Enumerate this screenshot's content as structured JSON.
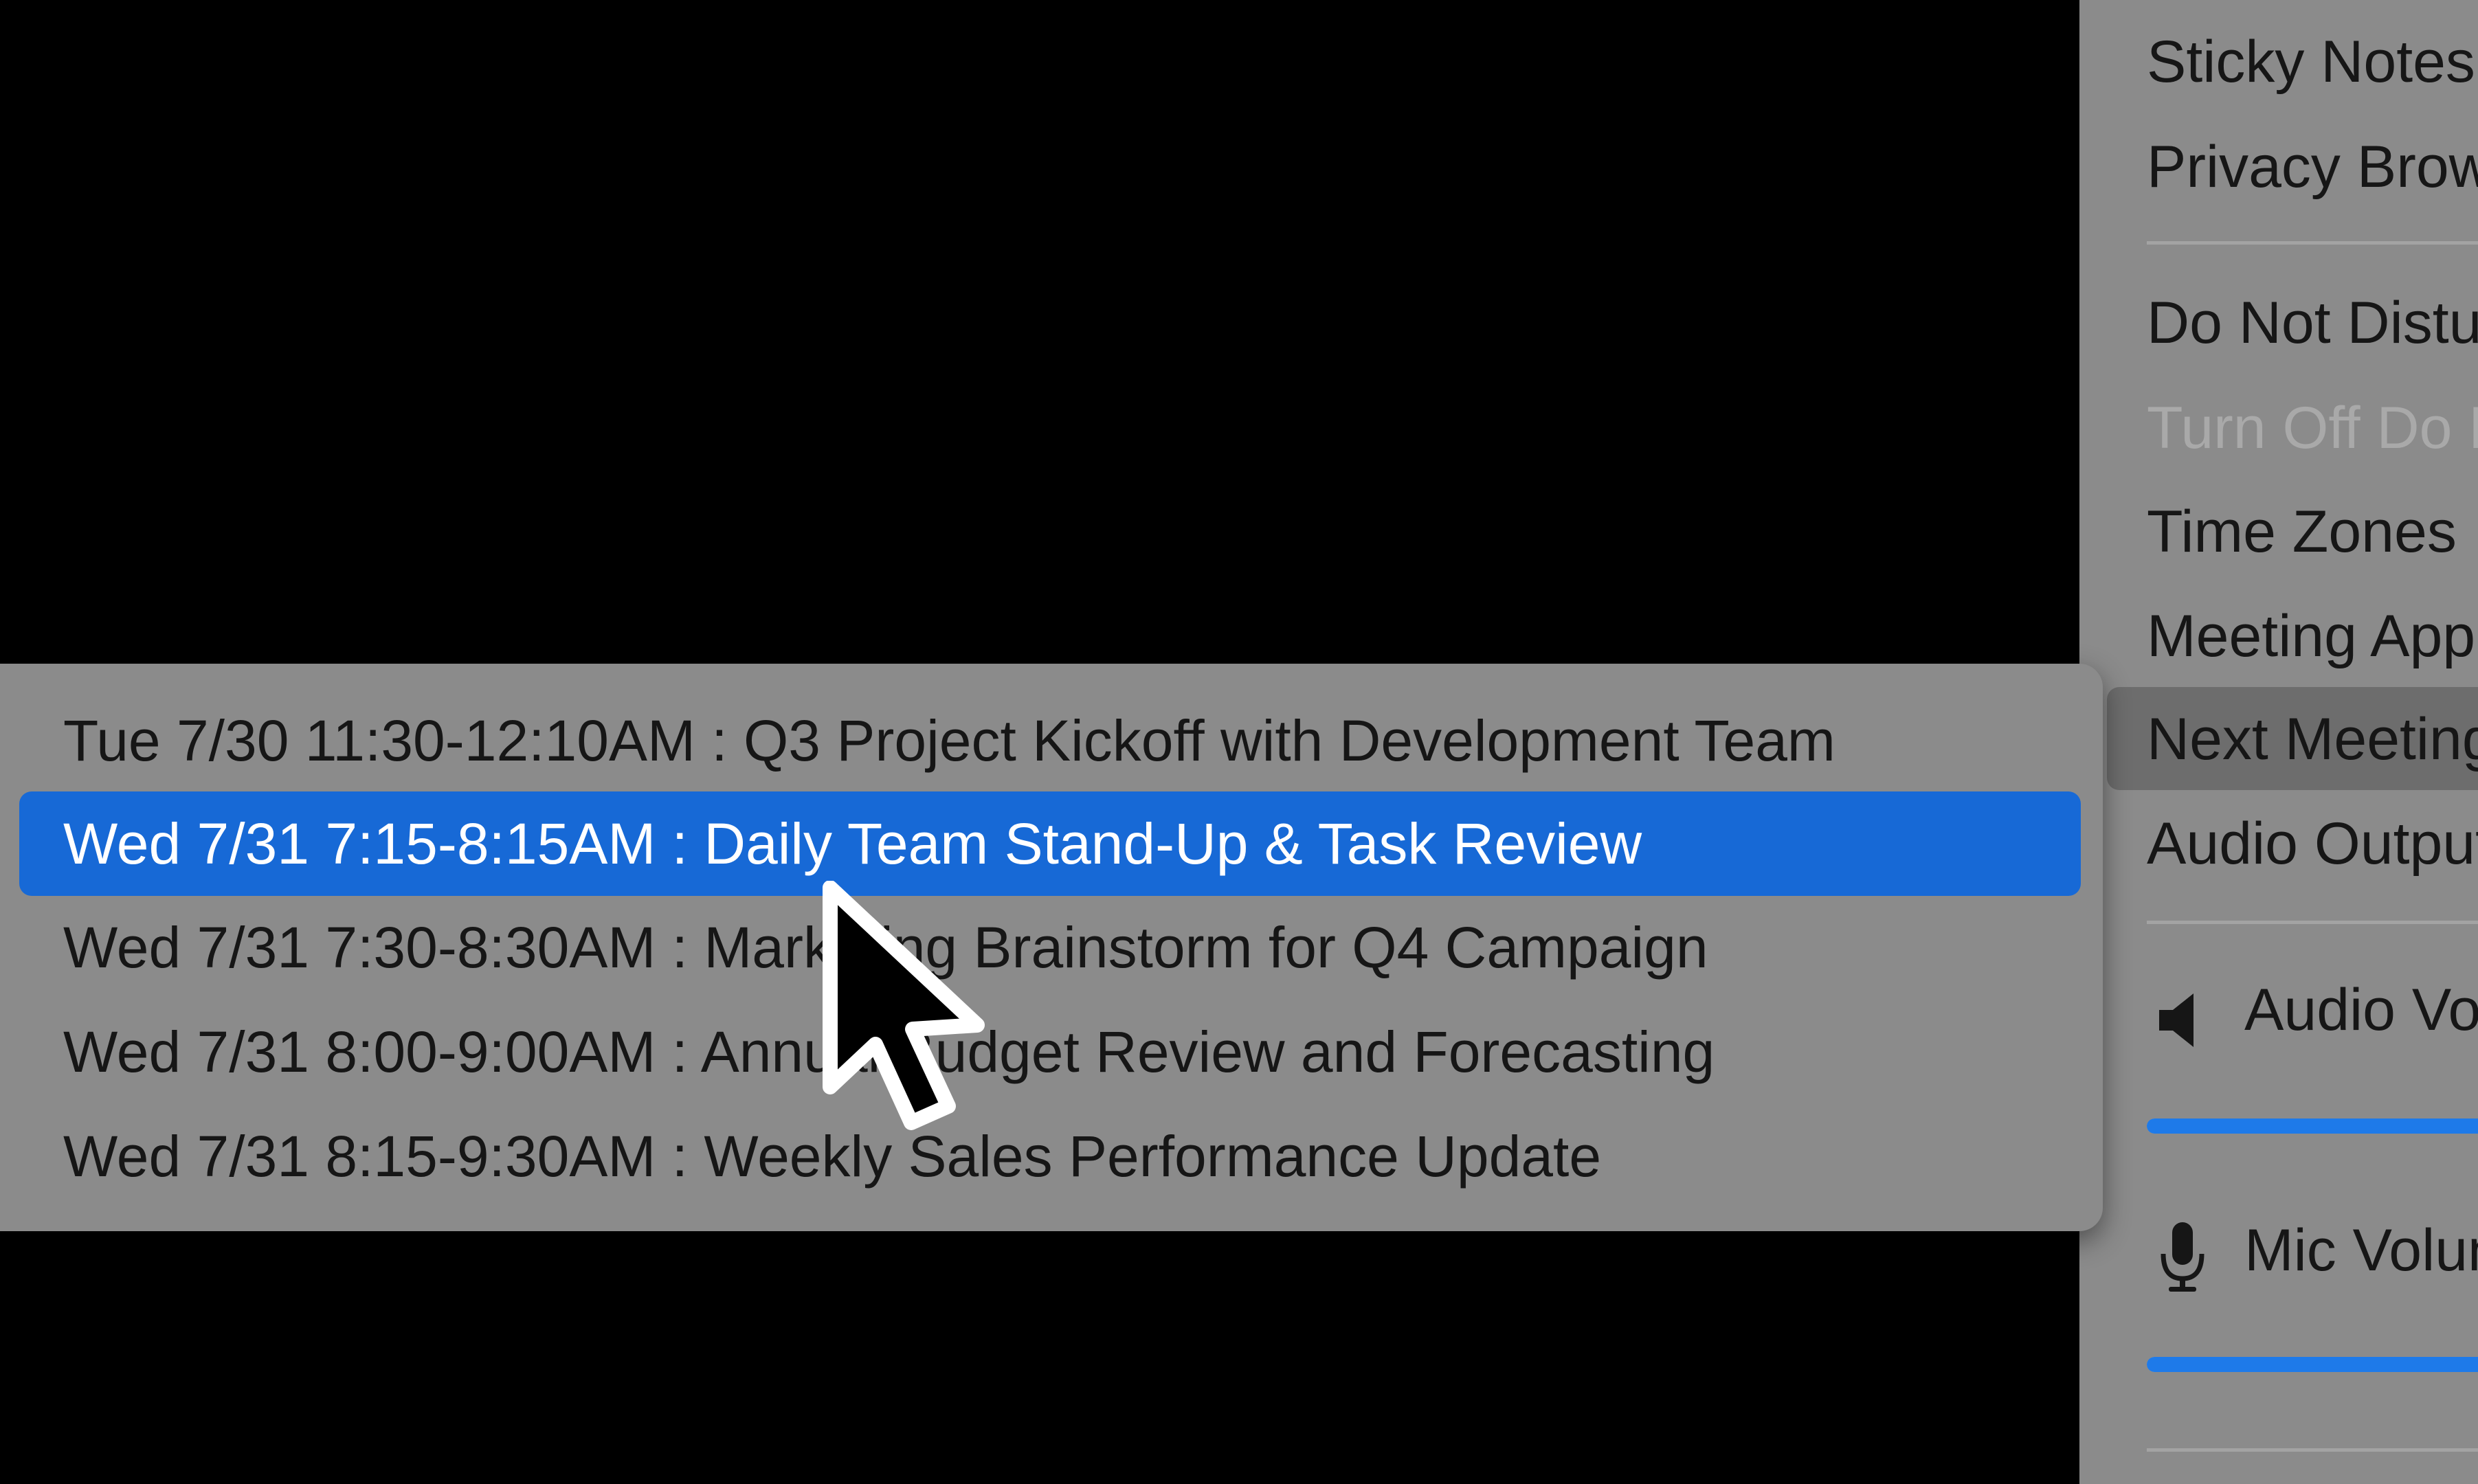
{
  "main_menu": {
    "items": [
      {
        "label": "Sticky Notes",
        "disabled": false
      },
      {
        "label": "Privacy Browser",
        "disabled": false
      },
      {
        "label": "Do Not Disturb",
        "disabled": false
      },
      {
        "label": "Turn Off Do Not Disturb",
        "disabled": true
      },
      {
        "label": "Time Zones",
        "disabled": false
      },
      {
        "label": "Meeting App",
        "disabled": false
      },
      {
        "label": "Next Meeting",
        "disabled": false,
        "highlighted": true
      },
      {
        "label": "Audio Output",
        "disabled": false
      }
    ],
    "audio_volume": {
      "label": "Audio Volume",
      "icon": "speaker-icon",
      "level": 1.0
    },
    "mic_volume": {
      "label": "Mic Volume",
      "icon": "microphone-icon",
      "level": 1.0
    }
  },
  "next_meeting_submenu": {
    "items": [
      {
        "label": "Tue 7/30 11:30-12:10AM : Q3 Project Kickoff with Development Team",
        "selected": false
      },
      {
        "label": "Wed 7/31 7:15-8:15AM : Daily Team Stand-Up & Task Review",
        "selected": true
      },
      {
        "label": "Wed 7/31 7:30-8:30AM : Marketing Brainstorm for Q4 Campaign",
        "selected": false
      },
      {
        "label": "Wed 7/31 8:00-9:00AM : Annual Budget Review and Forecasting",
        "selected": false
      },
      {
        "label": "Wed 7/31 8:15-9:30AM : Weekly Sales Performance Update",
        "selected": false
      }
    ]
  },
  "colors": {
    "menu_background": "#8b8b8b",
    "selection": "#1769d6",
    "slider_fill": "#1e7ae9",
    "text": "#161616",
    "disabled_text": "#a9a9a9"
  }
}
